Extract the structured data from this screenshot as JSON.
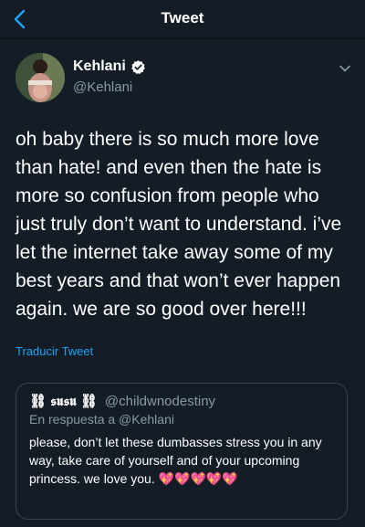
{
  "colors": {
    "background": "#141d26",
    "accent": "#1da1f2",
    "muted": "#8899a6",
    "border": "#38444d"
  },
  "navbar": {
    "title": "Tweet",
    "back_icon": "chevron-left-icon"
  },
  "author": {
    "display_name": "Kehlani",
    "handle": "@Kehlani",
    "verified_icon": "verified-badge-icon",
    "menu_icon": "chevron-down-icon"
  },
  "tweet": {
    "text": "oh baby there is so much more love\nthan hate! and even then the hate is\nmore so confusion from people who\njust truly don’t want to understand. i’ve\nlet the internet take away some of my\nbest years and that won’t ever happen\nagain. we are so good over here!!!",
    "translate_label": "Traducir Tweet"
  },
  "quoted_tweet": {
    "display_name": "⛓ 𝖘𝖚𝖘𝖚 ⛓",
    "handle": "@childwnodestiny",
    "reply_context": "En respuesta a @Kehlani",
    "text": "please, don’t let these dumbasses stress you in any way, take care of yourself and of your upcoming princess. we love you. 💖💖💖💖💖"
  }
}
